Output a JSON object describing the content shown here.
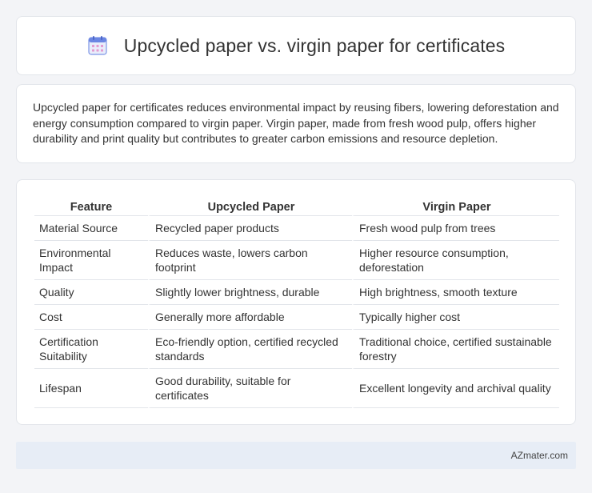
{
  "header": {
    "title": "Upcycled paper vs. virgin paper for certificates",
    "icon": "calendar-icon",
    "icon_color": "#5b7fe0"
  },
  "intro": {
    "text": "Upcycled paper for certificates reduces environmental impact by reusing fibers, lowering deforestation and energy consumption compared to virgin paper. Virgin paper, made from fresh wood pulp, offers higher durability and print quality but contributes to greater carbon emissions and resource depletion."
  },
  "table": {
    "headers": [
      "Feature",
      "Upcycled Paper",
      "Virgin Paper"
    ],
    "rows": [
      [
        "Material Source",
        "Recycled paper products",
        "Fresh wood pulp from trees"
      ],
      [
        "Environmental Impact",
        "Reduces waste, lowers carbon footprint",
        "Higher resource consumption, deforestation"
      ],
      [
        "Quality",
        "Slightly lower brightness, durable",
        "High brightness, smooth texture"
      ],
      [
        "Cost",
        "Generally more affordable",
        "Typically higher cost"
      ],
      [
        "Certification Suitability",
        "Eco-friendly option, certified recycled standards",
        "Traditional choice, certified sustainable forestry"
      ],
      [
        "Lifespan",
        "Good durability, suitable for certificates",
        "Excellent longevity and archival quality"
      ]
    ]
  },
  "footer": {
    "site": "AZmater.com"
  }
}
